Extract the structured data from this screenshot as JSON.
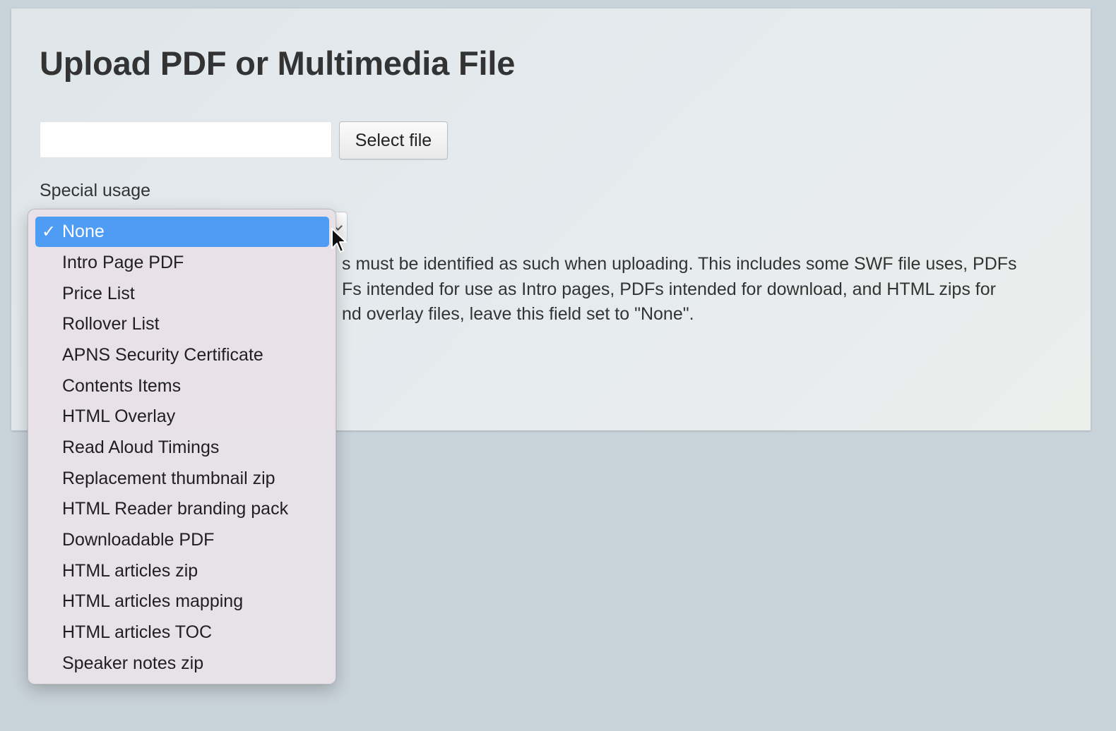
{
  "page": {
    "title": "Upload PDF or Multimedia File"
  },
  "file_input": {
    "value": "",
    "select_button_label": "Select file"
  },
  "special_usage": {
    "label": "Special usage",
    "selected_value": "None",
    "help_lines": [
      "s must be identified as such when uploading. This includes some SWF file uses, PDFs",
      "Fs intended for use as Intro pages, PDFs intended for download, and HTML zips for",
      "nd overlay files, leave this field set to \"None\"."
    ],
    "options": [
      "None",
      "Intro Page PDF",
      "Price List",
      "Rollover List",
      "APNS Security Certificate",
      "Contents Items",
      "HTML Overlay",
      "Read Aloud Timings",
      "Replacement thumbnail zip",
      "HTML Reader branding pack",
      "Downloadable PDF",
      "HTML articles zip",
      "HTML articles mapping",
      "HTML articles TOC",
      "Speaker notes zip"
    ],
    "selected_index": 0,
    "check_glyph": "✓"
  },
  "colors": {
    "page_background": "#c9d3da",
    "selected_option": "#4f9cf5",
    "menu_background": "#e8e2e8",
    "text": "#333333"
  },
  "icons": {
    "check": "checkmark-icon",
    "chevron": "chevron-down-icon",
    "cursor": "mouse-pointer-icon"
  }
}
